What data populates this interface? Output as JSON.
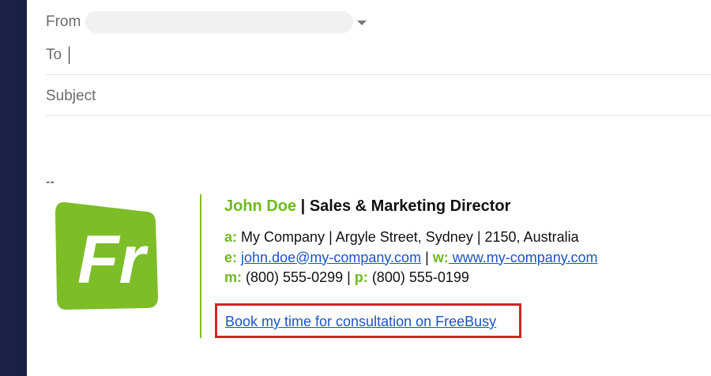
{
  "header": {
    "from_label": "From",
    "to_label": "To",
    "to_value": "",
    "subject_placeholder": "Subject"
  },
  "signature": {
    "dashes": "--",
    "name": "John Doe",
    "separator": " | ",
    "title": "Sales & Marketing Director",
    "address_label": "a:",
    "address": "My Company | Argyle Street, Sydney | 2150, Australia",
    "email_label": "e:",
    "email": "john.doe@my-company.com",
    "mid_separator": " | ",
    "web_label": "w:",
    "web": " www.my-company.com",
    "mobile_label": "m:",
    "mobile": "(800) 555-0299",
    "phone_separator": " | ",
    "phone_label": "p:",
    "phone": "(800) 555-0199",
    "booking_link": "Book my time for consultation on FreeBusy",
    "logo_text": "Fr"
  },
  "colors": {
    "accent_green": "#6dbb1f",
    "link_blue": "#1a55c4",
    "highlight_red": "#d42426"
  }
}
